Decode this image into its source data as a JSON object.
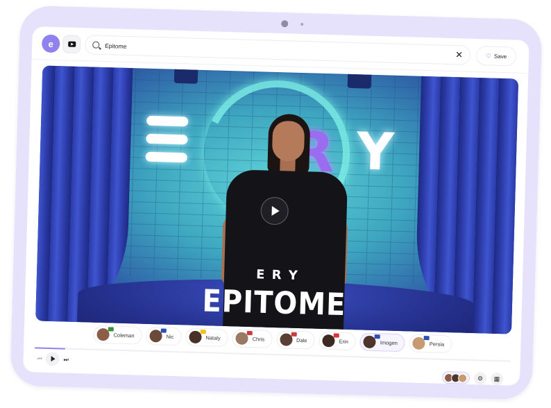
{
  "header": {
    "logo_letter": "e",
    "source_icon": "youtube-icon",
    "search": {
      "value": "Epitome",
      "placeholder": ""
    },
    "save_label": "Save"
  },
  "video": {
    "title": "EPITOME",
    "play_icon": "play-icon",
    "neon_sign": [
      "E",
      "R",
      "Y"
    ],
    "shirt_text": "E R Y"
  },
  "presenters": [
    {
      "name": "Coleman",
      "flag": "#3a8f3a",
      "active": false
    },
    {
      "name": "Nic",
      "flag": "#2d4fb3",
      "active": false
    },
    {
      "name": "Nataly",
      "flag": "#f2c21c",
      "active": false
    },
    {
      "name": "Chris",
      "flag": "#c63d3d",
      "active": false
    },
    {
      "name": "Dale",
      "flag": "#c63d3d",
      "active": false
    },
    {
      "name": "Erin",
      "flag": "#d33",
      "active": false
    },
    {
      "name": "Imogen",
      "flag": "#2d4fb3",
      "active": true
    },
    {
      "name": "Persia",
      "flag": "#2d4fb3",
      "active": false
    }
  ],
  "player": {
    "progress": 0.064,
    "controls": [
      "previous-icon",
      "play-icon",
      "next-icon"
    ],
    "tools": [
      "settings-icon",
      "grid-icon"
    ]
  },
  "colors": {
    "accent": "#8f82ee",
    "frame": "#e6e2fb"
  }
}
